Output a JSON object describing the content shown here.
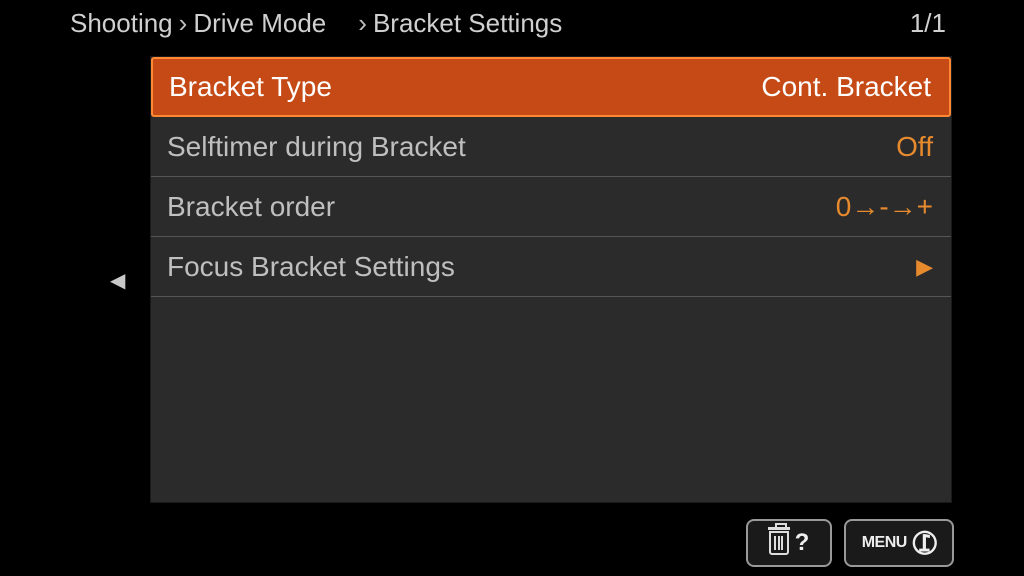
{
  "breadcrumb": {
    "items": [
      "Shooting",
      "Drive Mode",
      "Bracket Settings"
    ]
  },
  "page": {
    "current": 1,
    "total": 1,
    "display": "1/1"
  },
  "menu": {
    "items": [
      {
        "label": "Bracket Type",
        "value": "Cont. Bracket",
        "selected": true,
        "hasSubmenu": false
      },
      {
        "label": "Selftimer during Bracket",
        "value": "Off",
        "selected": false,
        "hasSubmenu": false
      },
      {
        "label": "Bracket order",
        "value": "0→-→+",
        "selected": false,
        "hasSubmenu": false
      },
      {
        "label": "Focus Bracket Settings",
        "value": "",
        "selected": false,
        "hasSubmenu": true
      }
    ]
  },
  "footer": {
    "help": "?",
    "menu": "MENU"
  }
}
